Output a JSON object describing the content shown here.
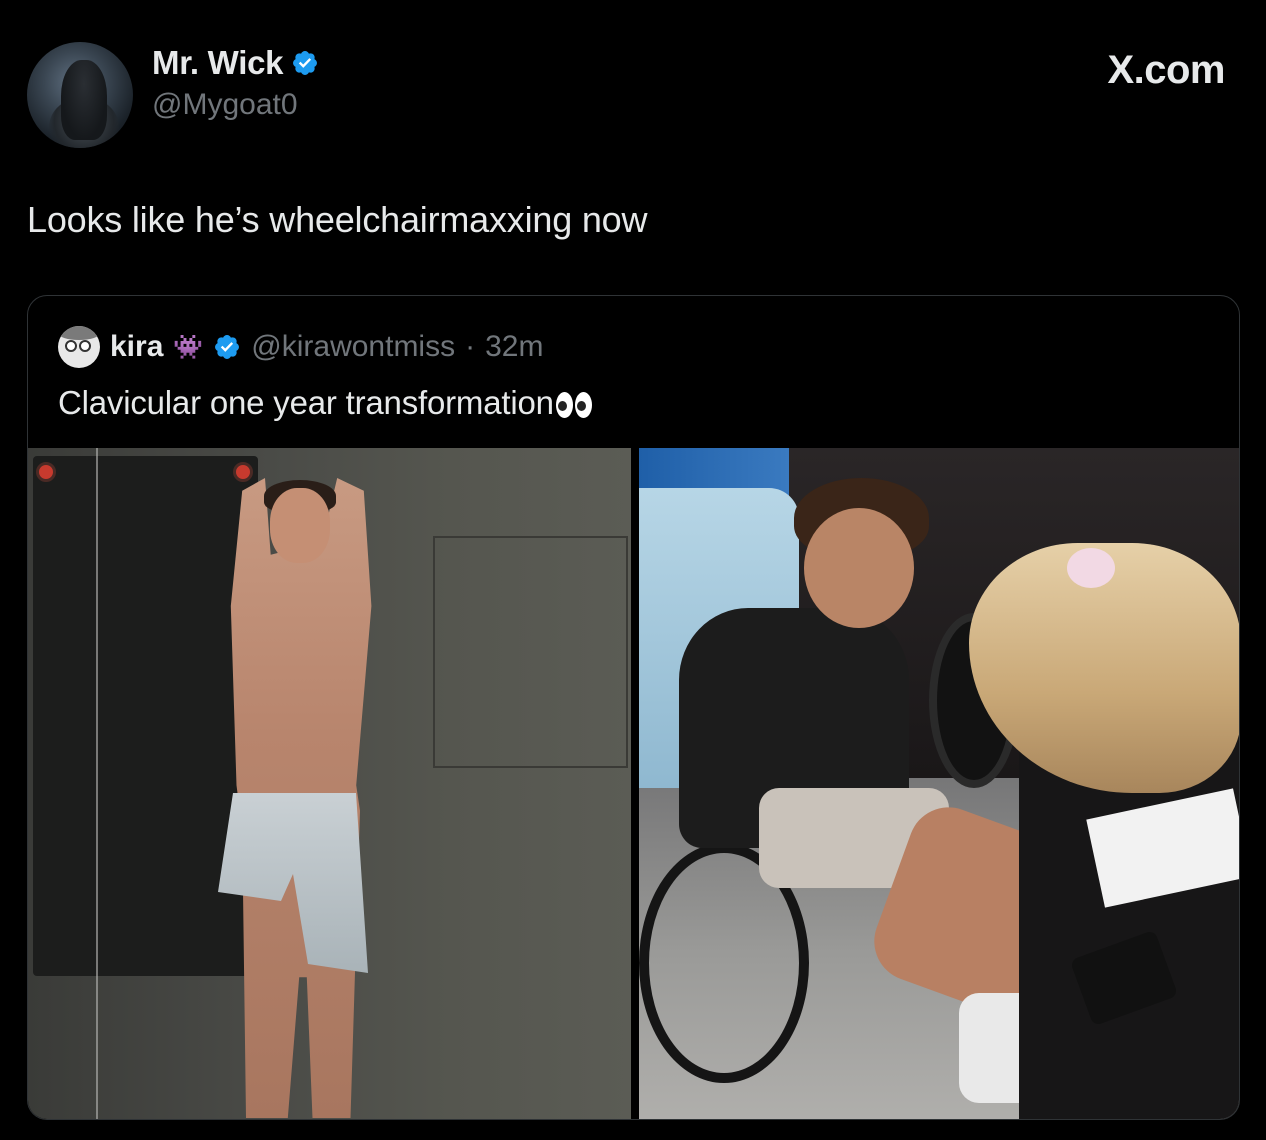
{
  "author": {
    "display_name": "Mr. Wick",
    "handle": "@Mygoat0",
    "verified": true
  },
  "watermark": "X.com",
  "tweet": {
    "text": "Looks like he’s wheelchairmaxxing now"
  },
  "quoted_tweet": {
    "display_name": "kira",
    "name_emoji": "👾",
    "verified": true,
    "handle": "@kirawontmiss",
    "separator": "·",
    "time": "32m",
    "text": "Clavicular one year transformation",
    "text_emoji": "eyes-icon",
    "images": [
      {
        "description_icon": "gym-photo"
      },
      {
        "description_icon": "wheelchair-photo"
      }
    ]
  },
  "colors": {
    "background": "#000000",
    "primary_text": "#e7e9ea",
    "secondary_text": "#71767b",
    "verified_blue": "#1d9bf0",
    "border": "#2f3336"
  }
}
